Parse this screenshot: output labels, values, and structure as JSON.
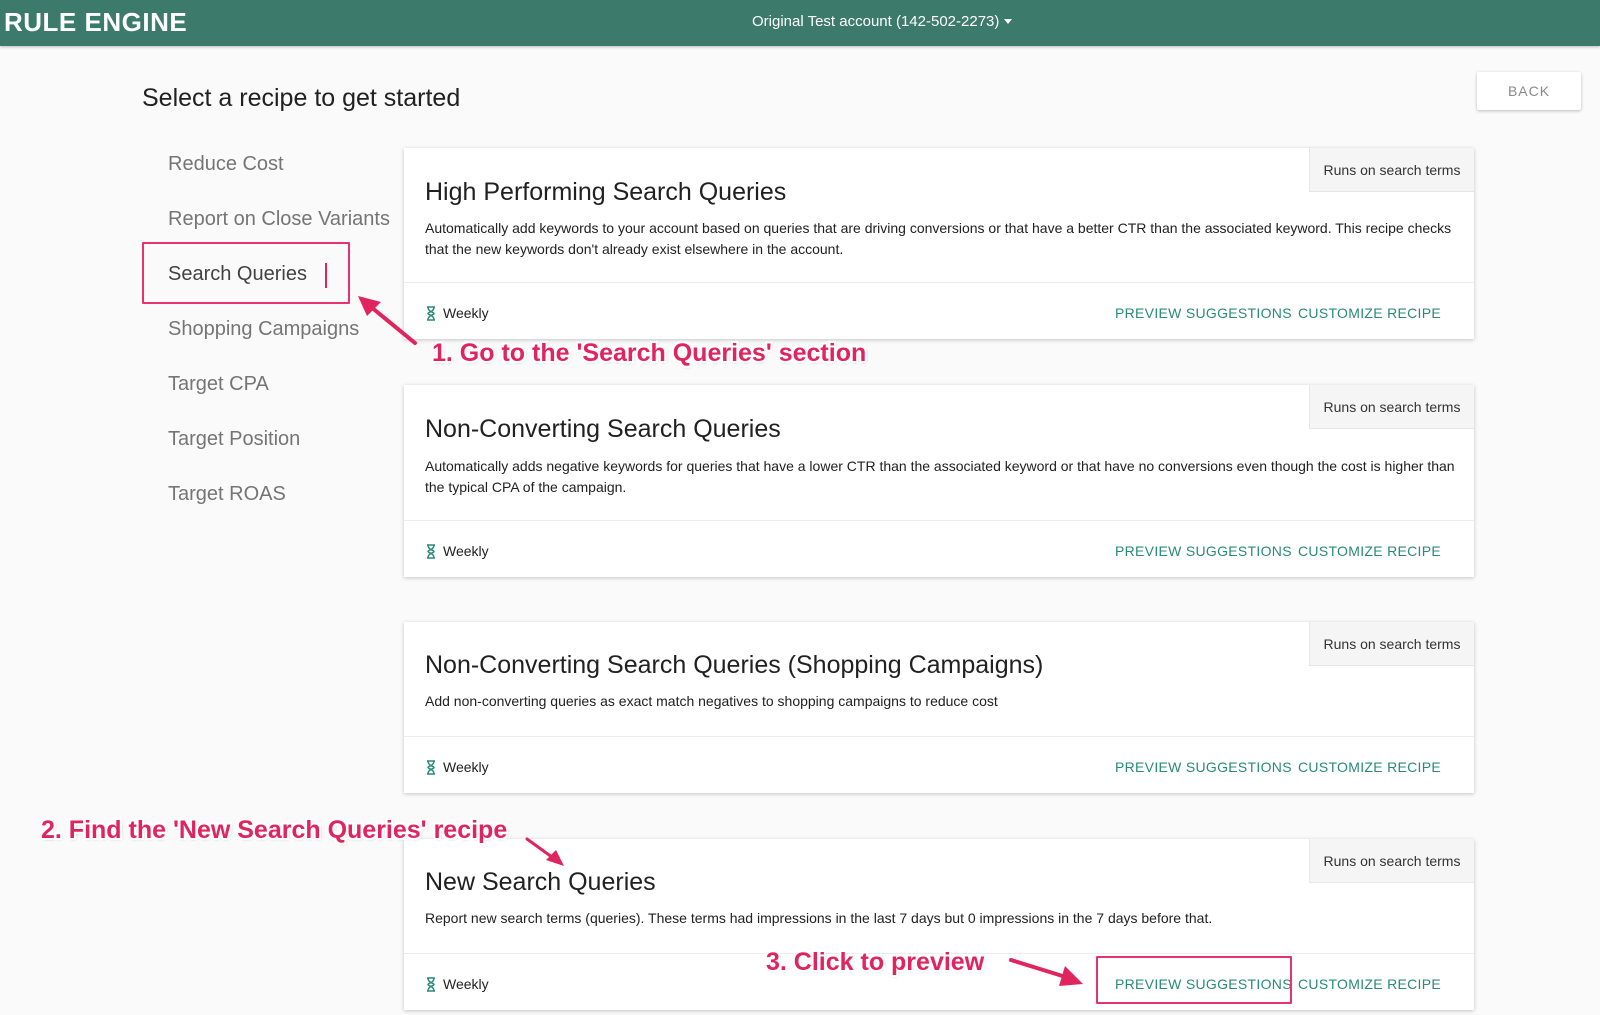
{
  "header": {
    "app_title": "RULE ENGINE",
    "account_label": "Original Test account (142-502-2273)"
  },
  "page": {
    "title": "Select a recipe to get started",
    "back_label": "BACK"
  },
  "sidebar": {
    "items": [
      {
        "label": "Reduce Cost"
      },
      {
        "label": "Report on Close Variants"
      },
      {
        "label": "Search Queries",
        "active": true
      },
      {
        "label": "Shopping Campaigns"
      },
      {
        "label": "Target CPA"
      },
      {
        "label": "Target Position"
      },
      {
        "label": "Target ROAS"
      }
    ]
  },
  "recipes": [
    {
      "tag": "Runs on search terms",
      "title": "High Performing Search Queries",
      "description": "Automatically add keywords to your account based on queries that are driving conversions or that have a better CTR than the associated keyword. This recipe checks that the new keywords don't already exist elsewhere in the account.",
      "frequency": "Weekly",
      "preview_label": "PREVIEW SUGGESTIONS",
      "customize_label": "CUSTOMIZE RECIPE"
    },
    {
      "tag": "Runs on search terms",
      "title": "Non-Converting Search Queries",
      "description": "Automatically adds negative keywords for queries that have a lower CTR than the associated keyword or that have no conversions even though the cost is higher than the typical CPA of the campaign.",
      "frequency": "Weekly",
      "preview_label": "PREVIEW SUGGESTIONS",
      "customize_label": "CUSTOMIZE RECIPE"
    },
    {
      "tag": "Runs on search terms",
      "title": "Non-Converting Search Queries (Shopping Campaigns)",
      "description": "Add non-converting queries as exact match negatives to shopping campaigns to reduce cost",
      "frequency": "Weekly",
      "preview_label": "PREVIEW SUGGESTIONS",
      "customize_label": "CUSTOMIZE RECIPE"
    },
    {
      "tag": "Runs on search terms",
      "title": "New Search Queries",
      "description": "Report new search terms (queries). These terms had impressions in the last 7 days but 0 impressions in the 7 days before that.",
      "frequency": "Weekly",
      "preview_label": "PREVIEW SUGGESTIONS",
      "customize_label": "CUSTOMIZE RECIPE"
    }
  ],
  "annotations": {
    "step1": "1. Go to the 'Search Queries' section",
    "step2": "2. Find the 'New Search Queries' recipe",
    "step3": "3. Click to preview"
  },
  "colors": {
    "header_bg": "#3c7a6b",
    "link": "#2a8a78",
    "annotation": "#e0245e"
  }
}
